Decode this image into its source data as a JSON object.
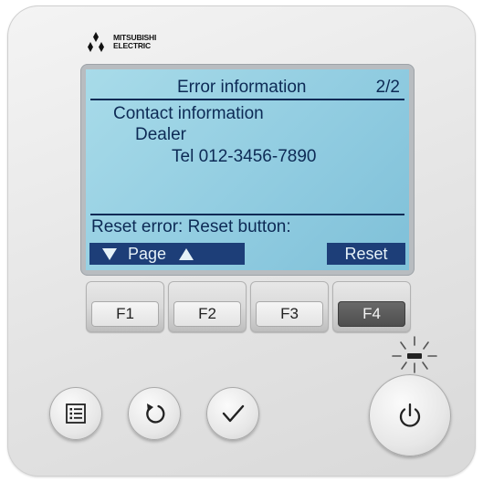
{
  "brand": {
    "line1": "MITSUBISHI",
    "line2": "ELECTRIC",
    "logo_color": "#111111"
  },
  "screen": {
    "title": "Error information",
    "page_indicator": "2/2",
    "lines": [
      "Contact information",
      "Dealer",
      "Tel 012-3456-7890"
    ],
    "prompt": "Reset error: Reset button:",
    "softkeys": {
      "left_label": "Page",
      "right_label": "Reset"
    },
    "colors": {
      "background": "#a8dbe9",
      "text": "#0d2a55",
      "softkey_bg": "#1d3e78"
    }
  },
  "function_keys": [
    {
      "label": "F1",
      "active": false
    },
    {
      "label": "F2",
      "active": false
    },
    {
      "label": "F3",
      "active": false
    },
    {
      "label": "F4",
      "active": true
    }
  ],
  "buttons": {
    "menu_icon": "menu-list-icon",
    "return_icon": "return-arrow-icon",
    "confirm_icon": "checkmark-icon",
    "power_icon": "power-icon",
    "indicator_icon": "operation-lamp-icon"
  }
}
